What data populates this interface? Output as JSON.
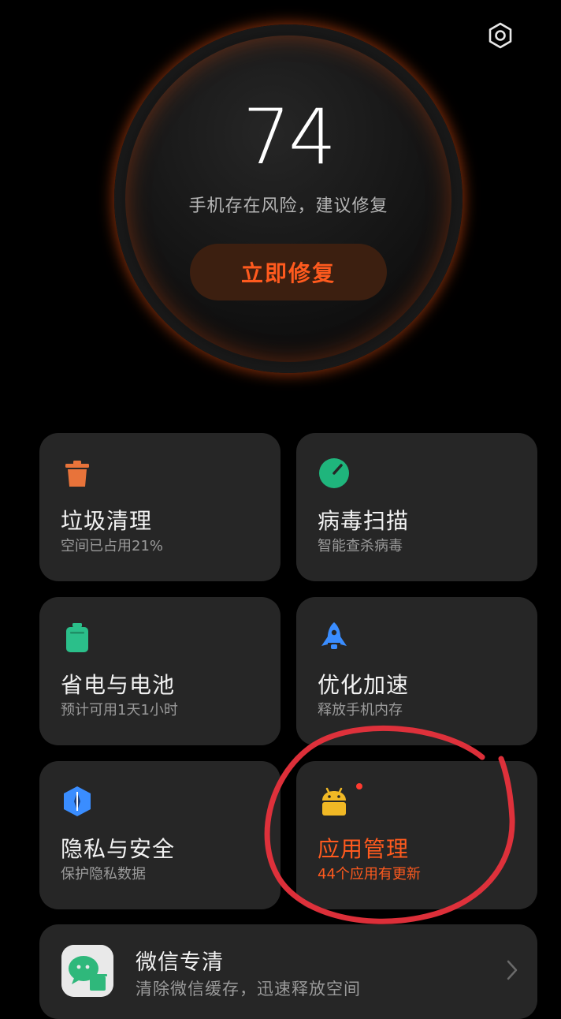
{
  "header": {
    "settings_icon": "gear-icon"
  },
  "score": {
    "value": "74",
    "caption": "手机存在风险，建议修复",
    "fix_button": "立即修复",
    "ring_color": "#ff6a1f"
  },
  "cards": [
    {
      "id": "junk",
      "icon": "trash-bin-icon",
      "icon_color": "#e8733a",
      "title": "垃圾清理",
      "subtitle": "空间已占用21%"
    },
    {
      "id": "virus",
      "icon": "radar-scan-icon",
      "icon_color": "#1fb57c",
      "title": "病毒扫描",
      "subtitle": "智能查杀病毒"
    },
    {
      "id": "battery",
      "icon": "battery-icon",
      "icon_color": "#2bbf8a",
      "title": "省电与电池",
      "subtitle": "预计可用1天1小时"
    },
    {
      "id": "boost",
      "icon": "rocket-icon",
      "icon_color": "#3a8dff",
      "title": "优化加速",
      "subtitle": "释放手机内存"
    },
    {
      "id": "privacy",
      "icon": "shield-icon",
      "icon_color": "#3a8dff",
      "title": "隐私与安全",
      "subtitle": "保护隐私数据"
    },
    {
      "id": "apps",
      "icon": "android-icon",
      "icon_color": "#f0b825",
      "title": "应用管理",
      "subtitle": "44个应用有更新",
      "badge": true
    }
  ],
  "wechat": {
    "icon": "wechat-clean-icon",
    "title": "微信专清",
    "subtitle": "清除微信缓存，迅速释放空间"
  },
  "colors": {
    "accent": "#ff5a1e",
    "card_bg": "#262626",
    "background": "#000000",
    "annotation": "#e8323c"
  }
}
